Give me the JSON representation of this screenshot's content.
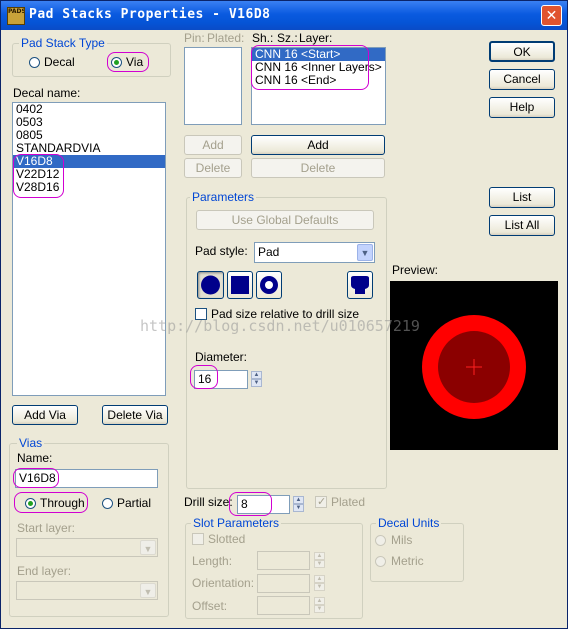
{
  "window": {
    "title": "Pad Stacks Properties - V16D8",
    "app_icon_text": "PADS",
    "close_glyph": "✕"
  },
  "pad_stack_type": {
    "label": "Pad Stack Type",
    "options": [
      {
        "label": "Decal",
        "selected": false
      },
      {
        "label": "Via",
        "selected": true
      }
    ]
  },
  "decal_name": {
    "label": "Decal name:",
    "items": [
      "0402",
      "0503",
      "0805",
      "STANDARDVIA",
      "V16D8",
      "V22D12",
      "V28D16"
    ],
    "selected": "V16D8"
  },
  "decal_buttons": {
    "add_via": "Add Via",
    "delete_via": "Delete Via"
  },
  "vias": {
    "label": "Vias",
    "name_label": "Name:",
    "name_value": "V16D8",
    "through": "Through",
    "partial": "Partial",
    "start_layer": "Start layer:",
    "end_layer": "End layer:"
  },
  "pin_list": {
    "pin_header": "Pin:",
    "plated_header": "Plated:"
  },
  "layer_list": {
    "sh_header": "Sh.:",
    "sz_header": "Sz.:",
    "layer_header": "Layer:",
    "items": [
      "CNN 16 <Start>",
      "CNN 16 <Inner Layers>",
      "CNN 16 <End>"
    ],
    "selected": "CNN 16 <Start>"
  },
  "list_buttons": {
    "add_left": "Add",
    "delete_left": "Delete",
    "add_right": "Add",
    "delete_right": "Delete"
  },
  "parameters": {
    "label": "Parameters",
    "use_global": "Use Global Defaults",
    "pad_style_label": "Pad style:",
    "pad_style_value": "Pad",
    "pad_size_relative": "Pad size relative to drill size",
    "diameter_label": "Diameter:",
    "diameter_value": "16"
  },
  "drill": {
    "label": "Drill size:",
    "value": "8",
    "plated": "Plated"
  },
  "slot": {
    "label": "Slot Parameters",
    "slotted": "Slotted",
    "length": "Length:",
    "orientation": "Orientation:",
    "offset": "Offset:"
  },
  "decal_units": {
    "label": "Decal Units",
    "mils": "Mils",
    "metric": "Metric"
  },
  "right_buttons": {
    "ok": "OK",
    "cancel": "Cancel",
    "help": "Help",
    "list": "List",
    "list_all": "List All"
  },
  "preview": {
    "label": "Preview:",
    "background": "#000000",
    "outer_color": "#ff0000",
    "inner_color": "#8b0000",
    "cross_color": "#ff2020"
  },
  "watermark": "http://blog.csdn.net/u010657219",
  "colors": {
    "highlight": "#d100d1",
    "selection": "#316ac5",
    "group_label": "#0046d5"
  }
}
